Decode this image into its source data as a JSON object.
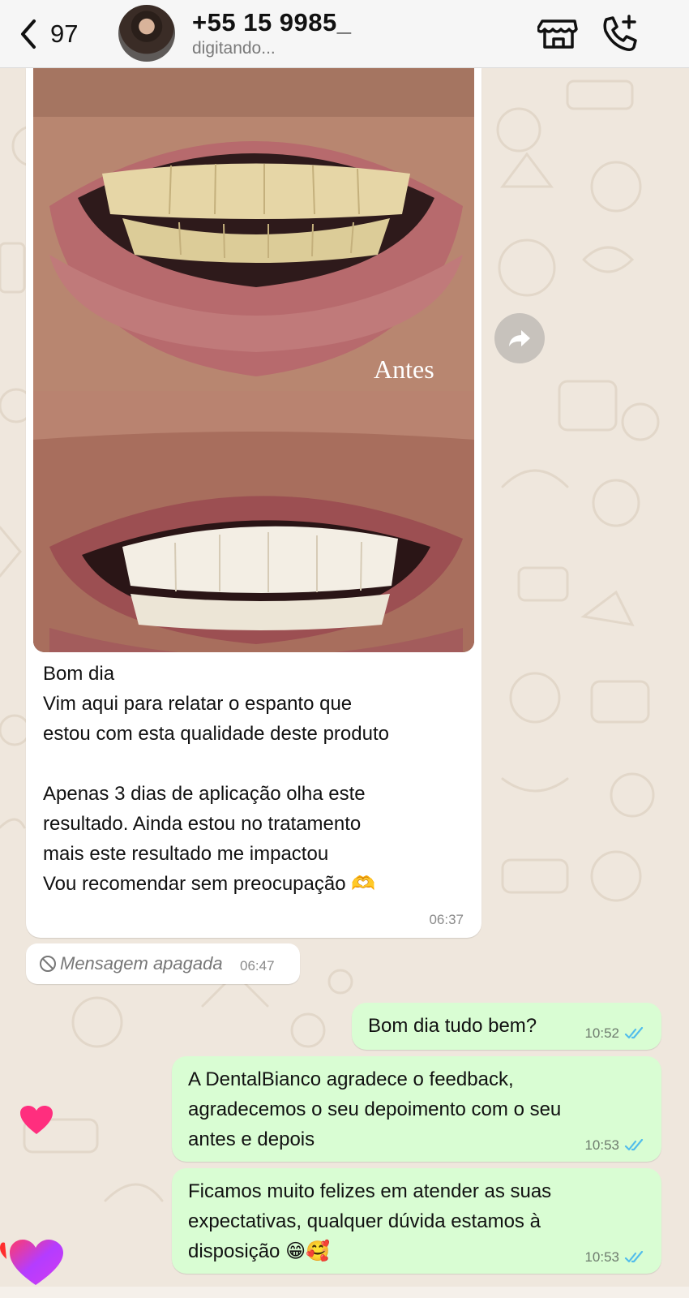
{
  "header": {
    "back_count": "97",
    "contact_name": "+55 15 9985_",
    "status": "digitando...",
    "back_icon": "chevron-left-icon",
    "store_icon": "storefront-icon",
    "call_icon": "add-call-icon"
  },
  "incoming": {
    "photo_label": "Antes",
    "text": "Bom dia\nVim aqui para relatar o espanto que\nestou com esta qualidade deste produto\n\nApenas 3 dias de aplicação olha este\nresultado. Ainda estou no tratamento\nmais este resultado me impactou\nVou recomendar sem preocupação 🫶",
    "time": "06:37"
  },
  "deleted": {
    "text": "Mensagem apagada",
    "time": "06:47"
  },
  "outgoing": [
    {
      "text": "Bom dia tudo bem?",
      "time": "10:52"
    },
    {
      "text": "A DentalBianco agradece o feedback,\nagradecemos o seu depoimento com o seu\nantes e depois",
      "time": "10:53"
    },
    {
      "text": "Ficamos muito felizes em atender as suas\nexpectativas, qualquer dúvida estamos à\ndisposição 😁🥰",
      "time": "10:53"
    }
  ],
  "colors": {
    "incoming_bg": "#ffffff",
    "outgoing_bg": "#d9fdd3",
    "wallpaper": "#efe7dd",
    "read_ticks": "#53bdeb",
    "heart": "#ff2e7e"
  }
}
